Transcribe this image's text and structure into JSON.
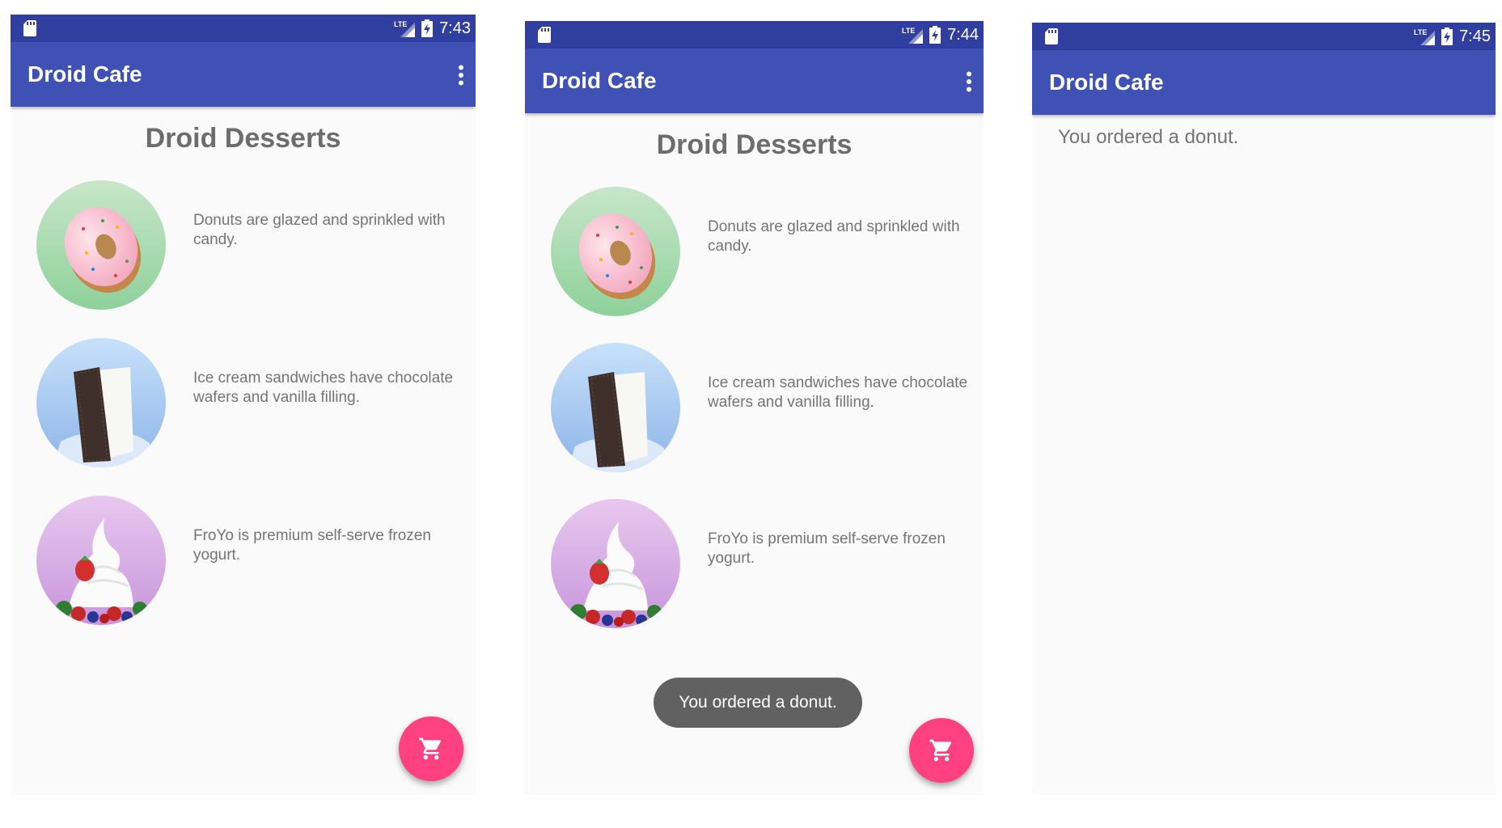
{
  "colors": {
    "statusbar": "#303f9f",
    "appbar": "#3f51b5",
    "fab": "#ff4081",
    "toast": "#616161",
    "text_secondary": "#757575"
  },
  "screens": [
    {
      "status": {
        "time": "7:43",
        "network": "LTE",
        "icons": [
          "sd-card-icon",
          "lte-signal-icon",
          "battery-charging-icon"
        ]
      },
      "app_title": "Droid Cafe",
      "menu_icon": "overflow-menu-icon",
      "heading": "Droid Desserts",
      "items": [
        {
          "image": "donut-image",
          "description": "Donuts are glazed and sprinkled with candy."
        },
        {
          "image": "ice-cream-sandwich-image",
          "description": "Ice cream sandwiches have chocolate wafers and vanilla filling."
        },
        {
          "image": "froyo-image",
          "description": "FroYo is premium self-serve frozen yogurt."
        }
      ],
      "fab_icon": "shopping-cart-icon"
    },
    {
      "status": {
        "time": "7:44",
        "network": "LTE",
        "icons": [
          "sd-card-icon",
          "lte-signal-icon",
          "battery-charging-icon"
        ]
      },
      "app_title": "Droid Cafe",
      "menu_icon": "overflow-menu-icon",
      "heading": "Droid Desserts",
      "items": [
        {
          "image": "donut-image",
          "description": "Donuts are glazed and sprinkled with candy."
        },
        {
          "image": "ice-cream-sandwich-image",
          "description": "Ice cream sandwiches have chocolate wafers and vanilla filling."
        },
        {
          "image": "froyo-image",
          "description": "FroYo is premium self-serve frozen yogurt."
        }
      ],
      "toast": "You ordered a donut.",
      "fab_icon": "shopping-cart-icon"
    },
    {
      "status": {
        "time": "7:45",
        "network": "LTE",
        "icons": [
          "sd-card-icon",
          "lte-signal-icon",
          "battery-charging-icon"
        ]
      },
      "app_title": "Droid Cafe",
      "order_message": "You ordered a donut."
    }
  ]
}
